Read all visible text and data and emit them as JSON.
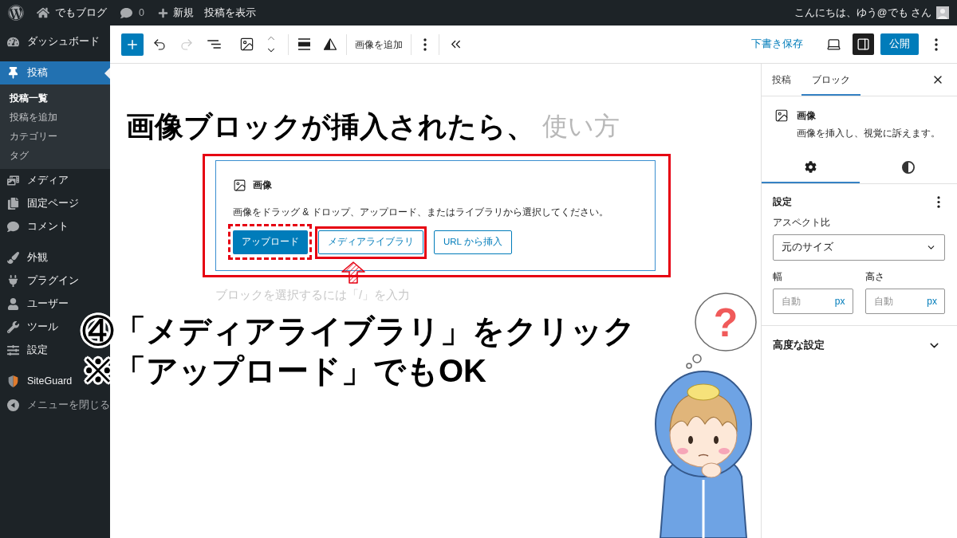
{
  "admin_bar": {
    "site_name": "でもブログ",
    "comment_count": "0",
    "new_label": "新規",
    "view_post": "投稿を表示",
    "greeting": "こんにちは、ゆう@でも さん"
  },
  "sidebar": {
    "groups": [
      {
        "items": [
          {
            "label": "ダッシュボード",
            "selected": false
          }
        ]
      },
      {
        "items": [
          {
            "label": "投稿",
            "selected": true,
            "children": [
              {
                "label": "投稿一覧",
                "selected": true
              },
              {
                "label": "投稿を追加",
                "selected": false
              },
              {
                "label": "カテゴリー",
                "selected": false
              },
              {
                "label": "タグ",
                "selected": false
              }
            ]
          },
          {
            "label": "メディア",
            "selected": false
          },
          {
            "label": "固定ページ",
            "selected": false
          },
          {
            "label": "コメント",
            "selected": false
          }
        ]
      },
      {
        "items": [
          {
            "label": "外観",
            "selected": false
          },
          {
            "label": "プラグイン",
            "selected": false
          },
          {
            "label": "ユーザー",
            "selected": false
          },
          {
            "label": "ツール",
            "selected": false
          },
          {
            "label": "設定",
            "selected": false
          }
        ]
      },
      {
        "items": [
          {
            "label": "SiteGuard",
            "selected": false
          }
        ]
      }
    ],
    "collapse_label": "メニューを閉じる"
  },
  "header": {
    "undo": {
      "disabled": false
    },
    "redo": {
      "disabled": true
    },
    "add_image": "画像を追加",
    "save_draft": "下書き保存",
    "settings_toggle": {
      "pressed": true
    },
    "publish": "公開"
  },
  "canvas": {
    "post_title": "使い方",
    "image_block": {
      "highlighted": true,
      "title": "画像",
      "instructions": "画像をドラッグ & ドロップ、アップロード、またはライブラリから選択してください。",
      "buttons": [
        {
          "label": "アップロード",
          "kind": "primary",
          "highlight": {
            "kind": "dashed"
          }
        },
        {
          "label": "メディアライブラリ",
          "kind": "secondary",
          "highlight": {
            "kind": "solid"
          }
        },
        {
          "label": "URL から挿入",
          "kind": "secondary",
          "highlight": {
            "kind": "none"
          }
        }
      ]
    },
    "appender_placeholder": "ブロックを選択するには「/」を入力"
  },
  "settings_panel": {
    "tabs": [
      {
        "label": "投稿",
        "selected": false
      },
      {
        "label": "ブロック",
        "selected": true
      }
    ],
    "block_card": {
      "title": "画像",
      "description": "画像を挿入し、視覚に訴えます。"
    },
    "sub_tabs": [
      {
        "selected": true
      },
      {
        "selected": false
      }
    ],
    "section_title": "設定",
    "aspect_ratio": {
      "label": "アスペクト比",
      "value": "元のサイズ"
    },
    "width": {
      "label": "幅",
      "placeholder": "自動",
      "unit": "px"
    },
    "height": {
      "label": "高さ",
      "placeholder": "自動",
      "unit": "px"
    },
    "advanced": {
      "label": "高度な設定",
      "expanded": false
    }
  },
  "annotations": {
    "caption": "画像ブロックが挿入されたら、",
    "steps": [
      "④「メディアライブラリ」をクリック",
      "※「アップロード」でもOK"
    ],
    "thought_mark": "?"
  }
}
